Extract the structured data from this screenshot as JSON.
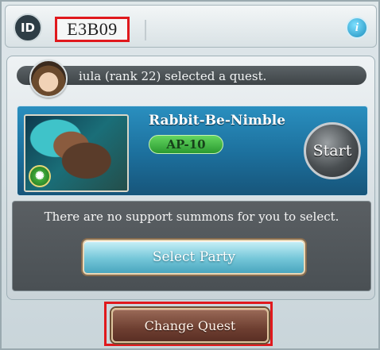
{
  "id_bar": {
    "badge_label": "ID",
    "room_code": "E3B09",
    "info_icon": "info-icon"
  },
  "notice": {
    "text": "iula (rank 22) selected a quest."
  },
  "quest": {
    "title": "Rabbit-Be-Nimble",
    "ap_cost": "AP-10",
    "start_label": "Start",
    "element_icon": "wind-element-icon"
  },
  "support": {
    "message": "There are no support summons for you to select.",
    "select_party_label": "Select Party"
  },
  "footer": {
    "change_quest_label": "Change Quest"
  },
  "colors": {
    "highlight": "#e0191d",
    "quest_panel": "#1c6f9c",
    "ap_badge": "#2b9a31"
  }
}
